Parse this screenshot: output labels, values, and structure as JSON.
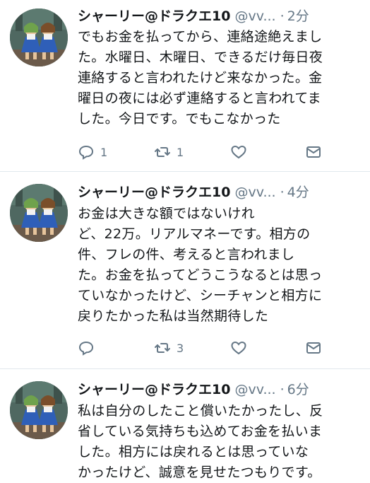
{
  "tweets": [
    {
      "name": "シャーリー@ドラクエ10",
      "handle": "@vv...",
      "time": "2分",
      "lines": [
        "でもお金を払ってから、連絡途絶えまし",
        "た。水曜日、木曜日、できるだけ毎日夜",
        "連絡すると言われたけど来なかった。金",
        "曜日の夜には必ず連絡すると言われてま",
        "した。今日です。でもこなかった"
      ],
      "reply_count": "1",
      "retweet_count": "1",
      "like_count": "",
      "mail_count": ""
    },
    {
      "name": "シャーリー@ドラクエ10",
      "handle": "@vv...",
      "time": "4分",
      "lines": [
        "お金は大きな額ではないけれ",
        "ど、22万。リアルマネーです。相方の",
        "件、フレの件、考えると言われまし",
        "た。お金を払ってどうこうなるとは思っ",
        "ていなかったけど、シーチャンと相方に",
        "戻りたかった私は当然期待した"
      ],
      "reply_count": "",
      "retweet_count": "3",
      "like_count": "",
      "mail_count": ""
    },
    {
      "name": "シャーリー@ドラクエ10",
      "handle": "@vv...",
      "time": "6分",
      "lines": [
        "私は自分のしたこと償いたかったし、反",
        "省している気持ちも込めてお金を払いま",
        "した。相方には戻れるとは思っていな",
        "かったけど、誠意を見せたつもりです。"
      ],
      "reply_count": "",
      "retweet_count": "",
      "like_count": "",
      "mail_count": ""
    }
  ],
  "icons": {
    "reply": "reply-icon",
    "retweet": "retweet-icon",
    "like": "heart-icon",
    "dm": "mail-icon"
  },
  "colors": {
    "text": "#14171a",
    "secondary": "#657786",
    "divider": "#e1e8ed"
  }
}
